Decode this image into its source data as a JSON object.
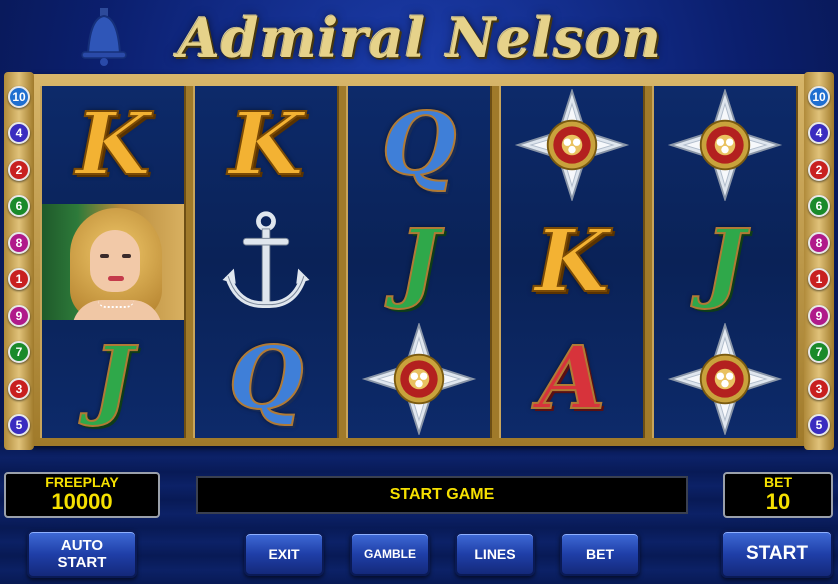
{
  "title": "Admiral Nelson",
  "grid": [
    [
      {
        "symbol": "K",
        "icon": "k-letter"
      },
      {
        "symbol": "lady",
        "icon": "lady-portrait-icon"
      },
      {
        "symbol": "J",
        "icon": "j-letter"
      }
    ],
    [
      {
        "symbol": "K",
        "icon": "k-letter"
      },
      {
        "symbol": "anchor",
        "icon": "anchor-icon"
      },
      {
        "symbol": "Q",
        "icon": "q-letter"
      }
    ],
    [
      {
        "symbol": "Q",
        "icon": "q-letter"
      },
      {
        "symbol": "J",
        "icon": "j-letter"
      },
      {
        "symbol": "star",
        "icon": "order-star-icon"
      }
    ],
    [
      {
        "symbol": "star",
        "icon": "order-star-icon"
      },
      {
        "symbol": "K",
        "icon": "k-letter"
      },
      {
        "symbol": "A",
        "icon": "a-letter"
      }
    ],
    [
      {
        "symbol": "star",
        "icon": "order-star-icon"
      },
      {
        "symbol": "J",
        "icon": "j-letter"
      },
      {
        "symbol": "star",
        "icon": "order-star-icon"
      }
    ]
  ],
  "line_numbers": {
    "left": [
      {
        "n": "10",
        "color": "#1f6fd0"
      },
      {
        "n": "4",
        "color": "#3a2cc0"
      },
      {
        "n": "2",
        "color": "#c82020"
      },
      {
        "n": "6",
        "color": "#1a8a2a"
      },
      {
        "n": "8",
        "color": "#b01a8a"
      },
      {
        "n": "1",
        "color": "#c82020"
      },
      {
        "n": "9",
        "color": "#b01a8a"
      },
      {
        "n": "7",
        "color": "#1a8a2a"
      },
      {
        "n": "3",
        "color": "#c82020"
      },
      {
        "n": "5",
        "color": "#3a2cc0"
      }
    ],
    "right": [
      {
        "n": "10",
        "color": "#1f6fd0"
      },
      {
        "n": "4",
        "color": "#3a2cc0"
      },
      {
        "n": "2",
        "color": "#c82020"
      },
      {
        "n": "6",
        "color": "#1a8a2a"
      },
      {
        "n": "8",
        "color": "#b01a8a"
      },
      {
        "n": "1",
        "color": "#c82020"
      },
      {
        "n": "9",
        "color": "#b01a8a"
      },
      {
        "n": "7",
        "color": "#1a8a2a"
      },
      {
        "n": "3",
        "color": "#c82020"
      },
      {
        "n": "5",
        "color": "#3a2cc0"
      }
    ]
  },
  "freeplay": {
    "label": "FREEPLAY",
    "value": "10000"
  },
  "bet": {
    "label": "BET",
    "value": "10"
  },
  "message": "START GAME",
  "buttons": {
    "auto_start": "AUTO\nSTART",
    "exit": "EXIT",
    "gamble": "GAMBLE",
    "lines": "LINES",
    "bet": "BET",
    "start": "START"
  },
  "colors": {
    "accent": "#f5e000",
    "reel_bg": "#0a2257",
    "frame": "#c7a45a"
  }
}
